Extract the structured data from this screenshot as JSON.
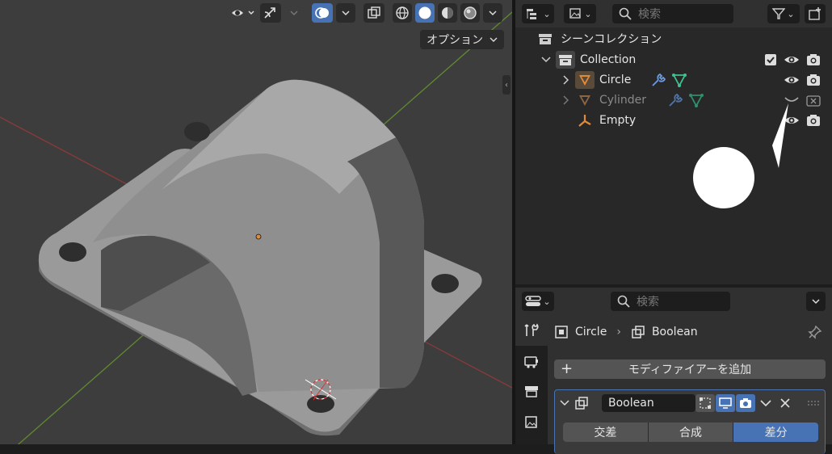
{
  "viewport": {
    "options_label": "オプション",
    "icons": [
      "visibility-icon",
      "gizmo-icon",
      "overlay-icon",
      "xray-icon",
      "wireframe-shading-icon",
      "solid-shading-icon",
      "material-shading-icon",
      "rendered-shading-icon"
    ]
  },
  "outliner": {
    "search_placeholder": "検索",
    "scene_collection": "シーンコレクション",
    "rows": [
      {
        "label": "Collection",
        "kind": "collection"
      },
      {
        "label": "Circle",
        "kind": "mesh",
        "visible": true
      },
      {
        "label": "Cylinder",
        "kind": "mesh",
        "visible": false
      },
      {
        "label": "Empty",
        "kind": "empty",
        "visible": true
      }
    ]
  },
  "properties": {
    "search_placeholder": "検索",
    "breadcrumb": {
      "object": "Circle",
      "modifier": "Boolean"
    },
    "add_modifier_label": "モディファイアーを追加",
    "modifier": {
      "name": "Boolean",
      "operations": [
        "交差",
        "合成",
        "差分"
      ],
      "active_operation": "差分"
    }
  },
  "colors": {
    "accent": "#4772b3",
    "mesh_orange": "#e08b3a",
    "modifier_blue": "#6d9de0",
    "vertex_green": "#3ec28f"
  }
}
